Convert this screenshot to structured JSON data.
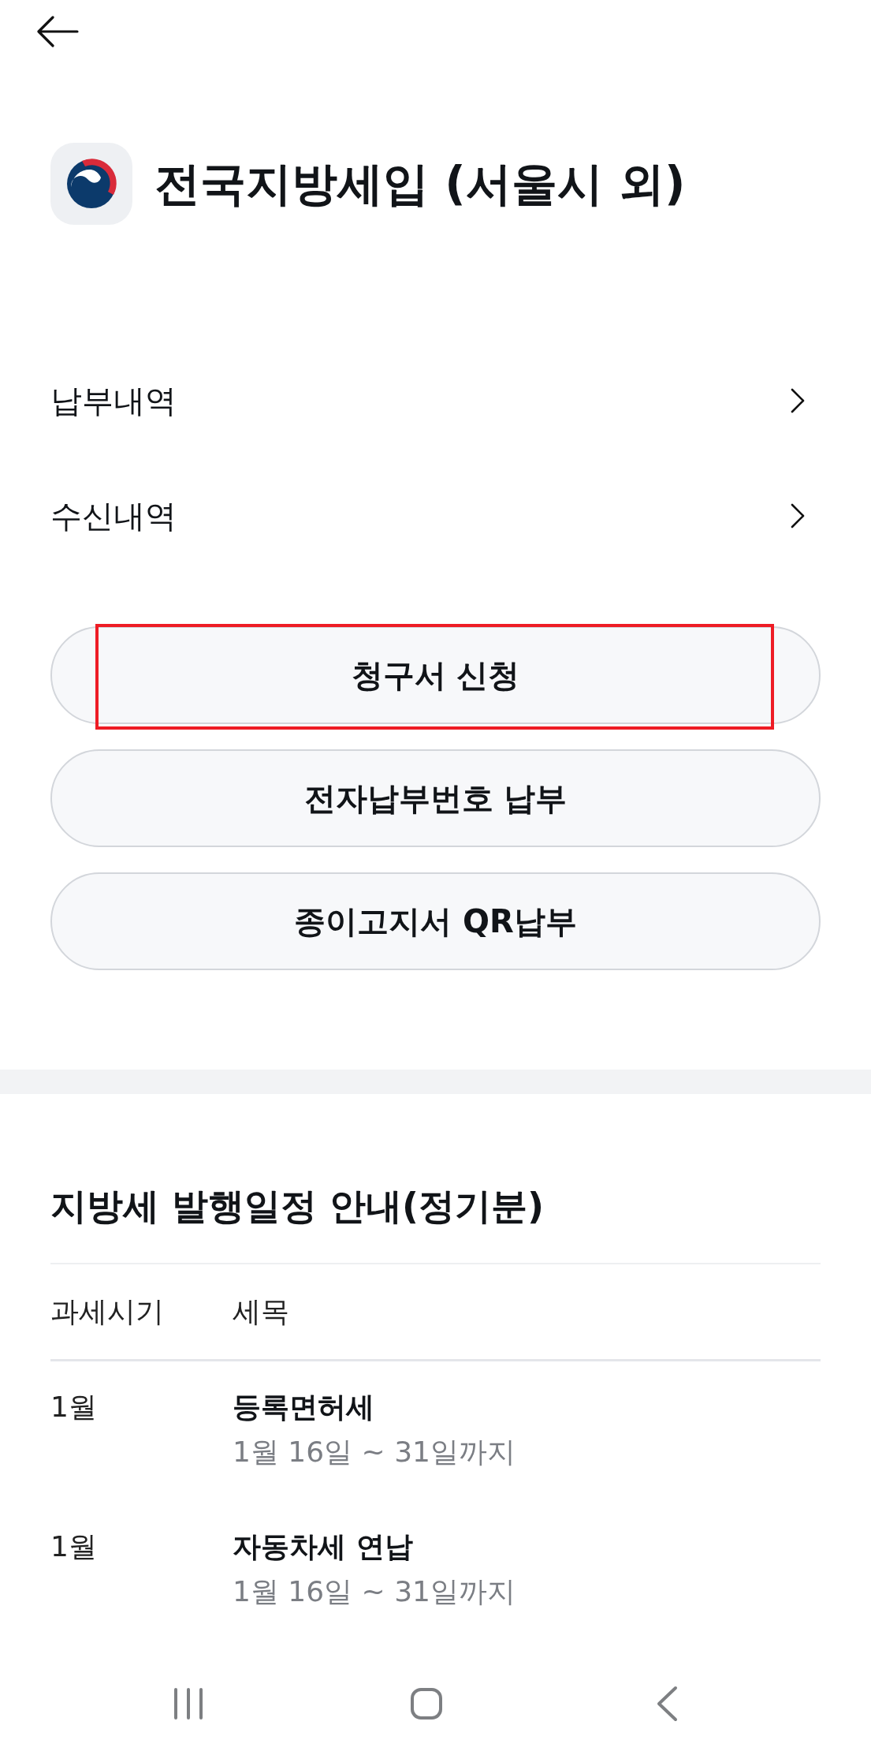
{
  "app": {
    "title": "전국지방세입 (서울시 외)"
  },
  "menu": [
    {
      "label": "납부내역"
    },
    {
      "label": "수신내역"
    }
  ],
  "buttons": [
    {
      "label": "청구서 신청",
      "highlighted": true
    },
    {
      "label": "전자납부번호 납부",
      "highlighted": false
    },
    {
      "label": "종이고지서 QR납부",
      "highlighted": false
    }
  ],
  "schedule": {
    "title": "지방세 발행일정 안내(정기분)",
    "columns": [
      "과세시기",
      "세목"
    ],
    "rows": [
      {
        "period": "1월",
        "tax": "등록면허세",
        "dates": "1월 16일 ~ 31일까지"
      },
      {
        "period": "1월",
        "tax": "자동차세 연납",
        "dates": "1월 16일 ~ 31일까지"
      }
    ]
  }
}
